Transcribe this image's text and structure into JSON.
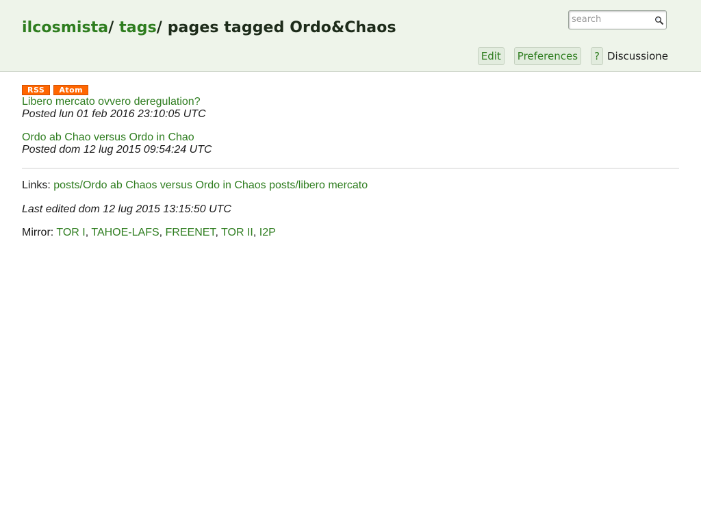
{
  "header": {
    "site_link": "ilcosmista",
    "sep1": "/",
    "tags_link": "tags",
    "sep2": "/",
    "page_title": "pages tagged Ordo&Chaos"
  },
  "search": {
    "placeholder": "search",
    "value": "",
    "icon": "search-icon"
  },
  "actions": {
    "edit": "Edit",
    "preferences": "Preferences",
    "help": "?",
    "discussion": "Discussione"
  },
  "feeds": {
    "rss": "RSS",
    "atom": "Atom"
  },
  "posts": [
    {
      "title": "Libero mercato ovvero deregulation?",
      "date": "Posted lun 01 feb 2016 23:10:05 UTC"
    },
    {
      "title": "Ordo ab Chao versus Ordo in Chao",
      "date": "Posted dom 12 lug 2015 09:54:24 UTC"
    }
  ],
  "footer": {
    "links_label": "Links:",
    "links": [
      "posts/Ordo ab Chaos versus Ordo in Chaos",
      "posts/libero mercato"
    ],
    "last_edited": "Last edited dom 12 lug 2015 13:15:50 UTC",
    "mirror_label": "Mirror:",
    "mirrors": [
      "TOR I",
      "TAHOE-LAFS",
      "FREENET",
      "TOR II",
      "I2P"
    ]
  },
  "colors": {
    "header_bg": "#eef4ea",
    "link": "#2e7d1f",
    "feed_orange": "#ff6600"
  }
}
